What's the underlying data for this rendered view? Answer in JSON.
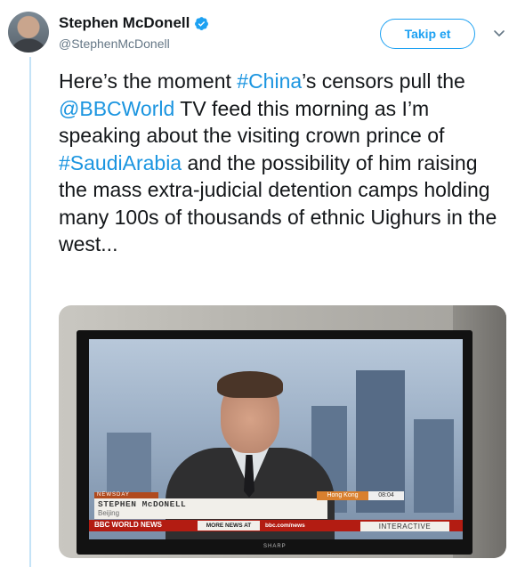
{
  "author": {
    "name": "Stephen McDonell",
    "handle": "@StephenMcDonell",
    "verified_icon": "verified-badge-icon"
  },
  "actions": {
    "follow_label": "Takip et",
    "more_icon": "chevron-down-icon"
  },
  "tweet": {
    "segments": [
      {
        "text": "Here’s the moment ",
        "link": false
      },
      {
        "text": "#China",
        "link": true
      },
      {
        "text": "’s censors pull the ",
        "link": false
      },
      {
        "text": "@BBCWorld",
        "link": true
      },
      {
        "text": " TV feed this morning as I’m speaking about the visiting crown prince of ",
        "link": false
      },
      {
        "text": "#SaudiArabia",
        "link": true
      },
      {
        "text": " and the possibility of him raising the mass extra-judicial detention camps holding many 100s of thousands of ethnic Uighurs in the west...",
        "link": false
      }
    ]
  },
  "media": {
    "strap": "NEWSDAY",
    "name": "STEPHEN McDONELL",
    "location": "Beijing",
    "location_tag": "Hong Kong",
    "time": "08:04",
    "channel": "BBC WORLD NEWS",
    "more_news": "MORE NEWS AT",
    "url": "bbc.com/news",
    "interactive": "INTERACTIVE",
    "tv_brand": "SHARP"
  },
  "colors": {
    "link": "#1b95e0",
    "accent": "#1da1f2",
    "thread_line": "#c4e3f7"
  }
}
